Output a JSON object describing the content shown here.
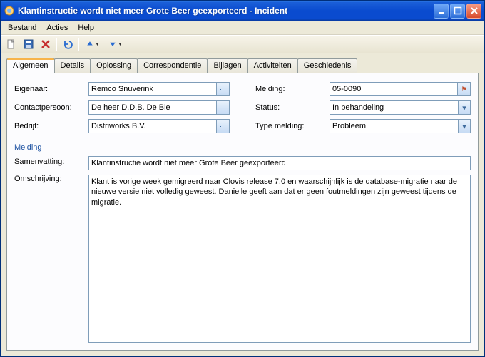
{
  "window": {
    "title": "Klantinstructie wordt niet meer Grote Beer geexporteerd - Incident"
  },
  "menus": {
    "file": "Bestand",
    "actions": "Acties",
    "help": "Help"
  },
  "tabs": {
    "general": "Algemeen",
    "details": "Details",
    "solution": "Oplossing",
    "correspondence": "Correspondentie",
    "attachments": "Bijlagen",
    "activities": "Activiteiten",
    "history": "Geschiedenis"
  },
  "labels": {
    "owner": "Eigenaar:",
    "contact": "Contactpersoon:",
    "company": "Bedrijf:",
    "report": "Melding:",
    "status": "Status:",
    "type": "Type melding:",
    "section": "Melding",
    "summary": "Samenvatting:",
    "description": "Omschrijving:"
  },
  "values": {
    "owner": "Remco Snuverink",
    "contact": "De heer D.D.B. De Bie",
    "company": "Distriworks B.V.",
    "report": "05-0090",
    "status": "In behandeling",
    "type": "Probleem",
    "summary": "Klantinstructie wordt niet meer Grote Beer geexporteerd",
    "description": "Klant is vorige week gemigreerd naar Clovis release 7.0 en waarschijnlijk is de database-migratie naar de nieuwe versie niet volledig geweest. Danielle geeft aan dat er geen foutmeldingen zijn geweest tijdens de migratie."
  }
}
